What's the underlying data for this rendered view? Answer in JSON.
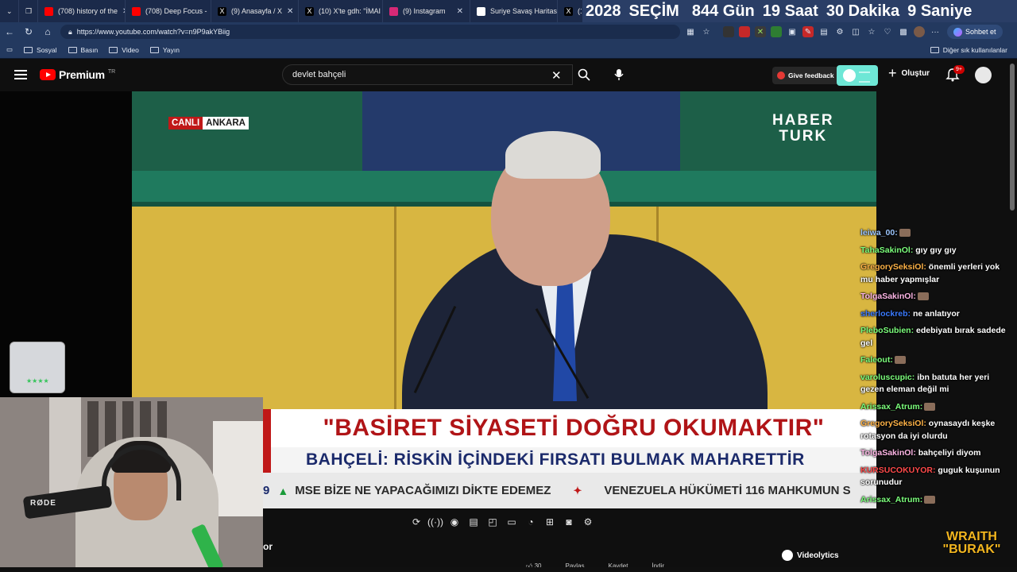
{
  "browser": {
    "tabs": [
      {
        "title": "(708) history of the",
        "icon_color": "#ff0000"
      },
      {
        "title": "(708) Deep Focus -",
        "icon_color": "#ff0000"
      },
      {
        "title": "(9) Anasayfa / X",
        "icon_color": "#ffffff"
      },
      {
        "title": "(10) X'te gdh: \"İMAI",
        "icon_color": "#ffffff"
      },
      {
        "title": "(9) Instagram",
        "icon_color": "#d62976"
      },
      {
        "title": "Suriye Savaş Haritas",
        "icon_color": "#ffffff"
      },
      {
        "title": "(1",
        "icon_color": "#ffffff"
      }
    ],
    "countdown": {
      "year": "2028",
      "label": "SEÇİM",
      "days": "844",
      "days_unit": "Gün",
      "hours": "19",
      "hours_unit": "Saat",
      "minutes": "30",
      "minutes_unit": "Dakika",
      "seconds": "9",
      "seconds_unit": "Saniye"
    },
    "url": "https://www.youtube.com/watch?v=n9P9akYBiig",
    "chat_button_label": "Sohbet et",
    "bookmarks": [
      "Sosyal",
      "Basın",
      "Video",
      "Yayın"
    ],
    "other_bookmarks": "Diğer sık kullanılanlar"
  },
  "youtube": {
    "brand": "Premium",
    "region": "TR",
    "search_value": "devlet bahçeli",
    "feedback_label": "Give feedback",
    "create_label": "Oluştur",
    "notification_count": "9+"
  },
  "video": {
    "live_label": "CANLI",
    "location_label": "ANKARA",
    "channel_line1": "HABER",
    "channel_line2": "TURK",
    "headline1": "\"BASİRET SİYASETİ DOĞRU OKUMAKTIR\"",
    "headline2": "BAHÇELİ: RİSKİN İÇİNDEKİ FIRSATI BULMAK MAHARETTİR",
    "ticker_prefix": "9",
    "ticker1": "MSE BİZE NE YAPACAĞIMIZI DİKTE EDEMEZ",
    "ticker2": "VENEZUELA HÜKÜMETİ 116 MAHKUMUN S",
    "description_fragment": "or"
  },
  "controls": [
    "loop-icon",
    "ambient-icon",
    "eye-icon",
    "subtitles-icon",
    "pip-icon",
    "theater-icon",
    "speed-icon",
    "add-icon",
    "screenshot-icon",
    "settings-icon"
  ],
  "actions": [
    "30",
    "Paylaş",
    "Kaydet",
    "İndir"
  ],
  "videolytics_label": "Videolytics",
  "webcam": {
    "mic_brand": "RØDE"
  },
  "chat": [
    {
      "user": "leiwa_00:",
      "text": "",
      "color": "#9ec7ff",
      "emote": true
    },
    {
      "user": "TahaSakinOl:",
      "text": "gıy gıy gıy",
      "color": "#7cff7c"
    },
    {
      "user": "GregorySeksiOl:",
      "text": "önemli yerleri yok mu haber yapmışlar",
      "color": "#ffb347"
    },
    {
      "user": "TolgaSakinOl:",
      "text": "",
      "color": "#ffb6e6",
      "emote": true
    },
    {
      "user": "sherlockreb:",
      "text": "ne anlatıyor",
      "color": "#3b7bff"
    },
    {
      "user": "PleboSubien:",
      "text": "edebiyatı bırak sadede gel",
      "color": "#7cff7c"
    },
    {
      "user": "Faleout:",
      "text": "",
      "color": "#7cff7c",
      "emote": true
    },
    {
      "user": "varoluscupic:",
      "text": "ibn batuta her yeri gezen eleman değil mi",
      "color": "#7cff7c"
    },
    {
      "user": "Arissax_Atrum:",
      "text": "",
      "color": "#7cff7c",
      "emote": true
    },
    {
      "user": "GregorySeksiOl:",
      "text": "oynasaydı keşke rotasyon da iyi olurdu",
      "color": "#ffb347"
    },
    {
      "user": "TolgaSakinOl:",
      "text": "bahçeliyi diyom",
      "color": "#ffb6e6"
    },
    {
      "user": "KURSUCOKUYOR:",
      "text": "guguk kuşunun sorunudur",
      "color": "#ff4a4a"
    },
    {
      "user": "Arissax_Atrum:",
      "text": "",
      "color": "#7cff7c",
      "emote": true
    }
  ],
  "overlay_brand_line1": "WRAITH",
  "overlay_brand_line2": "\"BURAK\""
}
